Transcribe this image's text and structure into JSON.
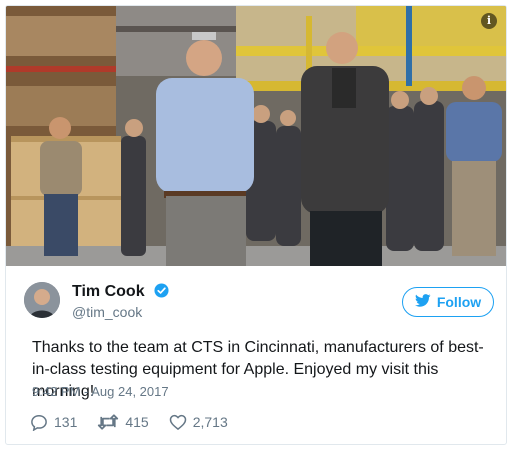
{
  "photo": {
    "info_icon": "info-icon",
    "info_glyph": "i"
  },
  "tweet": {
    "author_name": "Tim Cook",
    "author_handle": "@tim_cook",
    "verified_icon": "verified-badge-icon",
    "follow_label": "Follow",
    "text": "Thanks to the team at CTS in Cincinnati, manufacturers of best-in-class testing equipment for Apple. Enjoyed my visit this morning!",
    "timestamp": "9:42 PM - Aug 24, 2017",
    "replies": "131",
    "retweets": "415",
    "likes": "2,713"
  },
  "colors": {
    "accent": "#1da1f2",
    "muted": "#657786",
    "text": "#14171a",
    "border": "#e1e8ed"
  }
}
